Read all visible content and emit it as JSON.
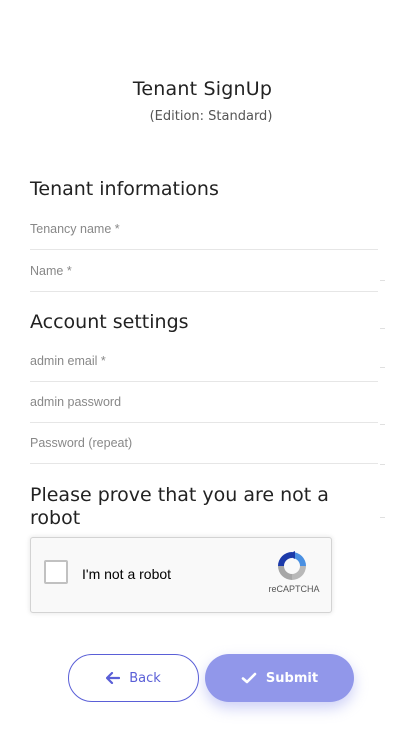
{
  "header": {
    "title": "Tenant SignUp",
    "edition": "(Edition: Standard)"
  },
  "tenant_section": {
    "heading": "Tenant informations",
    "tenancy_name_placeholder": "Tenancy name *",
    "name_placeholder": "Name *"
  },
  "account_section": {
    "heading": "Account settings",
    "admin_email_placeholder": "admin email *",
    "admin_password_placeholder": "admin password",
    "password_repeat_placeholder": "Password (repeat)"
  },
  "captcha": {
    "heading": "Please prove that you are not a robot",
    "checkbox_label": "I'm not a robot",
    "brand": "reCAPTCHA",
    "checked": false
  },
  "actions": {
    "back_label": "Back",
    "submit_label": "Submit"
  },
  "colors": {
    "accent": "#5a5fd7",
    "submit_bg": "#9197ea",
    "divider": "#e6e6e6"
  }
}
